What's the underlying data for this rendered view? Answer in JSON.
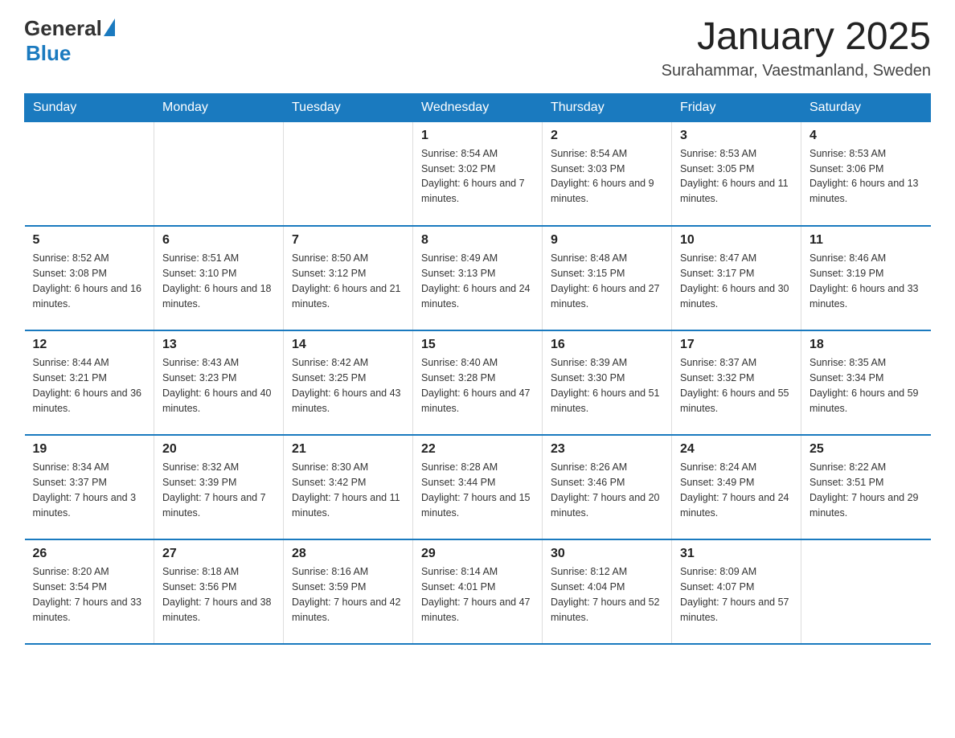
{
  "logo": {
    "general": "General",
    "blue": "Blue"
  },
  "header": {
    "month": "January 2025",
    "location": "Surahammar, Vaestmanland, Sweden"
  },
  "days_of_week": [
    "Sunday",
    "Monday",
    "Tuesday",
    "Wednesday",
    "Thursday",
    "Friday",
    "Saturday"
  ],
  "weeks": [
    [
      {
        "day": "",
        "info": ""
      },
      {
        "day": "",
        "info": ""
      },
      {
        "day": "",
        "info": ""
      },
      {
        "day": "1",
        "info": "Sunrise: 8:54 AM\nSunset: 3:02 PM\nDaylight: 6 hours and 7 minutes."
      },
      {
        "day": "2",
        "info": "Sunrise: 8:54 AM\nSunset: 3:03 PM\nDaylight: 6 hours and 9 minutes."
      },
      {
        "day": "3",
        "info": "Sunrise: 8:53 AM\nSunset: 3:05 PM\nDaylight: 6 hours and 11 minutes."
      },
      {
        "day": "4",
        "info": "Sunrise: 8:53 AM\nSunset: 3:06 PM\nDaylight: 6 hours and 13 minutes."
      }
    ],
    [
      {
        "day": "5",
        "info": "Sunrise: 8:52 AM\nSunset: 3:08 PM\nDaylight: 6 hours and 16 minutes."
      },
      {
        "day": "6",
        "info": "Sunrise: 8:51 AM\nSunset: 3:10 PM\nDaylight: 6 hours and 18 minutes."
      },
      {
        "day": "7",
        "info": "Sunrise: 8:50 AM\nSunset: 3:12 PM\nDaylight: 6 hours and 21 minutes."
      },
      {
        "day": "8",
        "info": "Sunrise: 8:49 AM\nSunset: 3:13 PM\nDaylight: 6 hours and 24 minutes."
      },
      {
        "day": "9",
        "info": "Sunrise: 8:48 AM\nSunset: 3:15 PM\nDaylight: 6 hours and 27 minutes."
      },
      {
        "day": "10",
        "info": "Sunrise: 8:47 AM\nSunset: 3:17 PM\nDaylight: 6 hours and 30 minutes."
      },
      {
        "day": "11",
        "info": "Sunrise: 8:46 AM\nSunset: 3:19 PM\nDaylight: 6 hours and 33 minutes."
      }
    ],
    [
      {
        "day": "12",
        "info": "Sunrise: 8:44 AM\nSunset: 3:21 PM\nDaylight: 6 hours and 36 minutes."
      },
      {
        "day": "13",
        "info": "Sunrise: 8:43 AM\nSunset: 3:23 PM\nDaylight: 6 hours and 40 minutes."
      },
      {
        "day": "14",
        "info": "Sunrise: 8:42 AM\nSunset: 3:25 PM\nDaylight: 6 hours and 43 minutes."
      },
      {
        "day": "15",
        "info": "Sunrise: 8:40 AM\nSunset: 3:28 PM\nDaylight: 6 hours and 47 minutes."
      },
      {
        "day": "16",
        "info": "Sunrise: 8:39 AM\nSunset: 3:30 PM\nDaylight: 6 hours and 51 minutes."
      },
      {
        "day": "17",
        "info": "Sunrise: 8:37 AM\nSunset: 3:32 PM\nDaylight: 6 hours and 55 minutes."
      },
      {
        "day": "18",
        "info": "Sunrise: 8:35 AM\nSunset: 3:34 PM\nDaylight: 6 hours and 59 minutes."
      }
    ],
    [
      {
        "day": "19",
        "info": "Sunrise: 8:34 AM\nSunset: 3:37 PM\nDaylight: 7 hours and 3 minutes."
      },
      {
        "day": "20",
        "info": "Sunrise: 8:32 AM\nSunset: 3:39 PM\nDaylight: 7 hours and 7 minutes."
      },
      {
        "day": "21",
        "info": "Sunrise: 8:30 AM\nSunset: 3:42 PM\nDaylight: 7 hours and 11 minutes."
      },
      {
        "day": "22",
        "info": "Sunrise: 8:28 AM\nSunset: 3:44 PM\nDaylight: 7 hours and 15 minutes."
      },
      {
        "day": "23",
        "info": "Sunrise: 8:26 AM\nSunset: 3:46 PM\nDaylight: 7 hours and 20 minutes."
      },
      {
        "day": "24",
        "info": "Sunrise: 8:24 AM\nSunset: 3:49 PM\nDaylight: 7 hours and 24 minutes."
      },
      {
        "day": "25",
        "info": "Sunrise: 8:22 AM\nSunset: 3:51 PM\nDaylight: 7 hours and 29 minutes."
      }
    ],
    [
      {
        "day": "26",
        "info": "Sunrise: 8:20 AM\nSunset: 3:54 PM\nDaylight: 7 hours and 33 minutes."
      },
      {
        "day": "27",
        "info": "Sunrise: 8:18 AM\nSunset: 3:56 PM\nDaylight: 7 hours and 38 minutes."
      },
      {
        "day": "28",
        "info": "Sunrise: 8:16 AM\nSunset: 3:59 PM\nDaylight: 7 hours and 42 minutes."
      },
      {
        "day": "29",
        "info": "Sunrise: 8:14 AM\nSunset: 4:01 PM\nDaylight: 7 hours and 47 minutes."
      },
      {
        "day": "30",
        "info": "Sunrise: 8:12 AM\nSunset: 4:04 PM\nDaylight: 7 hours and 52 minutes."
      },
      {
        "day": "31",
        "info": "Sunrise: 8:09 AM\nSunset: 4:07 PM\nDaylight: 7 hours and 57 minutes."
      },
      {
        "day": "",
        "info": ""
      }
    ]
  ]
}
